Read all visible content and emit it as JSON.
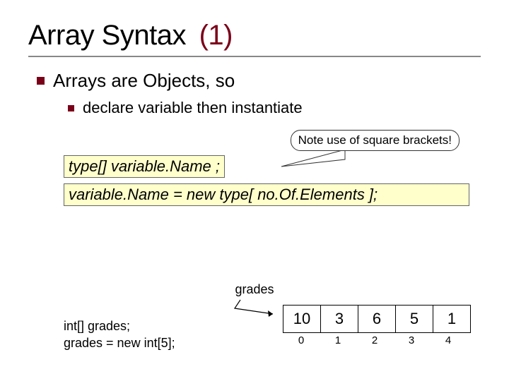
{
  "title": {
    "main": "Array Syntax",
    "paren": "(1)"
  },
  "bullets": {
    "b1": "Arrays are Objects, so",
    "b2": "declare variable then instantiate"
  },
  "callout": "Note use of square brackets!",
  "codebox1": "type[] variable.Name ;",
  "codebox2": "variable.Name = new type[ no.Of.Elements ];",
  "grades_label": "grades",
  "code_sample": {
    "l1": "int[] grades;",
    "l2": "grades = new int[5];"
  },
  "array": {
    "values": [
      "10",
      "3",
      "6",
      "5",
      "1"
    ],
    "indices": [
      "0",
      "1",
      "2",
      "3",
      "4"
    ]
  }
}
